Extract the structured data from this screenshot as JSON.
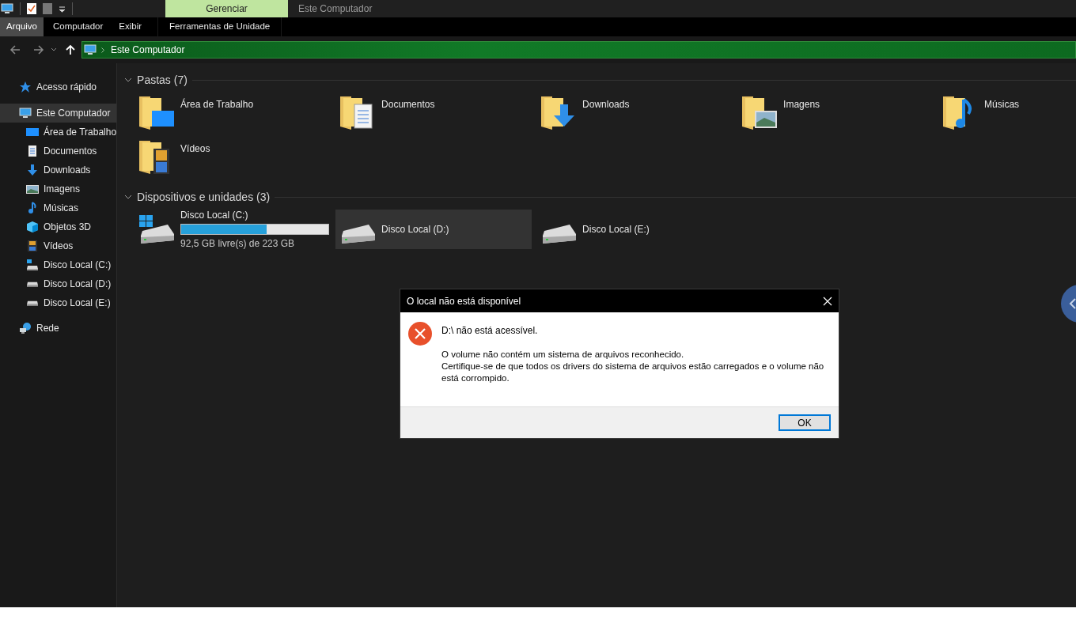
{
  "titlebar": {
    "contextual_tab": "Gerenciar",
    "title": "Este Computador"
  },
  "ribbon_tabs": [
    {
      "label": "Arquivo",
      "selected": true
    },
    {
      "label": "Computador",
      "selected": false
    },
    {
      "label": "Exibir",
      "selected": false
    },
    {
      "label": "Ferramentas de Unidade",
      "selected": false
    }
  ],
  "address": {
    "path": "Este Computador"
  },
  "sidebar": {
    "items": [
      {
        "label": "Acesso rápido",
        "selected": false
      },
      {
        "label": "Este Computador",
        "selected": true,
        "children": [
          {
            "label": "Área de Trabalho",
            "selected": false
          },
          {
            "label": "Documentos",
            "selected": false
          },
          {
            "label": "Downloads",
            "selected": false
          },
          {
            "label": "Imagens",
            "selected": false
          },
          {
            "label": "Músicas",
            "selected": false
          },
          {
            "label": "Objetos 3D",
            "selected": false
          },
          {
            "label": "Vídeos",
            "selected": false
          },
          {
            "label": "Disco Local (C:)",
            "selected": false
          },
          {
            "label": "Disco Local (D:)",
            "selected": false
          },
          {
            "label": "Disco Local (E:)",
            "selected": false
          }
        ]
      },
      {
        "label": "Rede",
        "selected": false
      }
    ]
  },
  "folders": {
    "title": "Pastas (7)",
    "expanded": true,
    "items": [
      {
        "label": "Área de Trabalho"
      },
      {
        "label": "Documentos"
      },
      {
        "label": "Downloads"
      },
      {
        "label": "Imagens"
      },
      {
        "label": "Músicas"
      },
      {
        "label": "Vídeos"
      }
    ]
  },
  "drives": {
    "title": "Dispositivos e unidades (3)",
    "expanded": true,
    "items": [
      {
        "label": "Disco Local (C:)",
        "selected": false,
        "level": 0.58,
        "reading": "92,5 GB livre(s) de 223 GB"
      },
      {
        "label": "Disco Local (D:)",
        "selected": true
      },
      {
        "label": "Disco Local (E:)",
        "selected": false
      }
    ]
  },
  "dialog": {
    "title": "O local não está disponível",
    "heading": "D:\\ não está acessível.",
    "message": [
      "O volume não contém um sistema de arquivos reconhecido.",
      "Certifique-se de que todos os drivers do sistema de arquivos estão carregados e o volume não está corrompido."
    ],
    "button": "OK"
  }
}
